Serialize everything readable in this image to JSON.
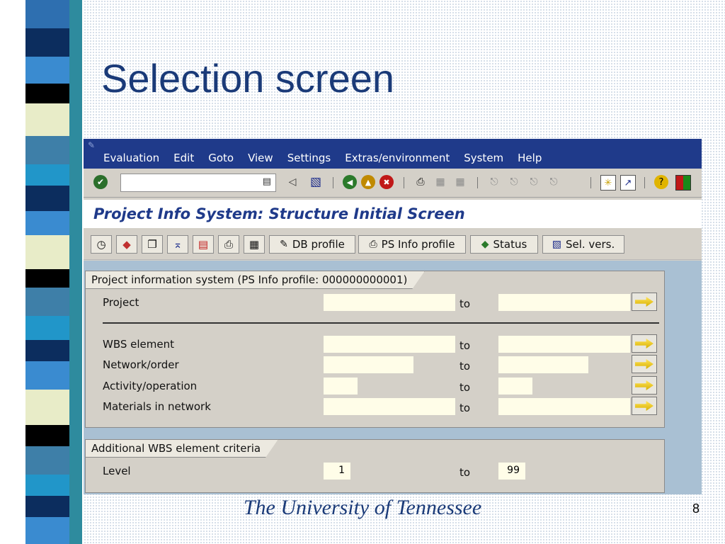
{
  "slide": {
    "title": "Selection screen",
    "footer": "The University of Tennessee",
    "page_number": "8"
  },
  "colors": {
    "menubar": "#1f3a8a",
    "title_text": "#1a3a78",
    "field_bg": "#fffde8",
    "content_bg": "#a9c0d3"
  },
  "menu": {
    "items": [
      "Evaluation",
      "Edit",
      "Goto",
      "View",
      "Settings",
      "Extras/environment",
      "System",
      "Help"
    ]
  },
  "toolbar": {
    "command_field_value": "",
    "icons": [
      "enter-icon",
      "back-icon",
      "save-icon",
      "exit-icon",
      "up-icon",
      "cancel-icon",
      "print-icon",
      "find-icon",
      "find-next-icon",
      "first-page-icon",
      "previous-page-icon",
      "next-page-icon",
      "last-page-icon",
      "create-session-icon",
      "shortcut-icon",
      "help-icon",
      "layout-icon"
    ]
  },
  "screen": {
    "title": "Project Info System: Structure Initial Screen"
  },
  "app_toolbar": {
    "db_profile": "DB profile",
    "ps_info_profile": "PS Info profile",
    "status": "Status",
    "sel_vers": "Sel. vers."
  },
  "group1": {
    "title": "Project information system (PS Info profile: 000000000001)",
    "to_label": "to",
    "rows": [
      {
        "label": "Project",
        "from": "",
        "to": ""
      },
      {
        "label": "WBS element",
        "from": "",
        "to": ""
      },
      {
        "label": "Network/order",
        "from": "",
        "to": ""
      },
      {
        "label": "Activity/operation",
        "from": "",
        "to": ""
      },
      {
        "label": "Materials in network",
        "from": "",
        "to": ""
      }
    ]
  },
  "group2": {
    "title": "Additional WBS element criteria",
    "to_label": "to",
    "level": {
      "label": "Level",
      "from": "1",
      "to": "99"
    }
  }
}
